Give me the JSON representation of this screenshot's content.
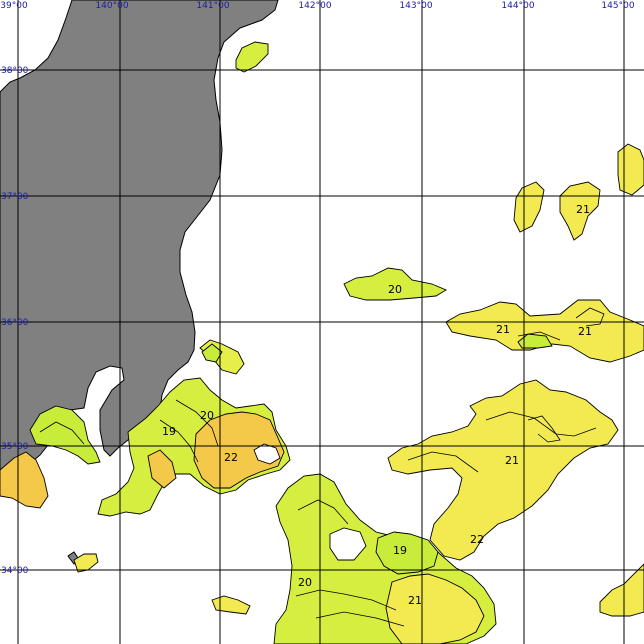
{
  "longitude_labels": [
    "39°00",
    "140°00",
    "141°00",
    "142°00",
    "143°00",
    "144°00",
    "145°00"
  ],
  "latitude_labels": [
    "38°00",
    "37°00",
    "36°00",
    "35°00",
    "34°00"
  ],
  "contour_labels": [
    "20",
    "21",
    "21",
    "21",
    "19",
    "20",
    "22",
    "21",
    "22",
    "19",
    "20",
    "21"
  ],
  "colors": {
    "land": "#808080",
    "water_background": "#ffffff",
    "temp_19_20": "#c8ec3a",
    "temp_20_21": "#e6ee4a",
    "temp_21_22": "#f2ea50",
    "temp_22_plus": "#f4c848",
    "grid": "#000000",
    "coordinate_text": "#1a1aa8"
  }
}
